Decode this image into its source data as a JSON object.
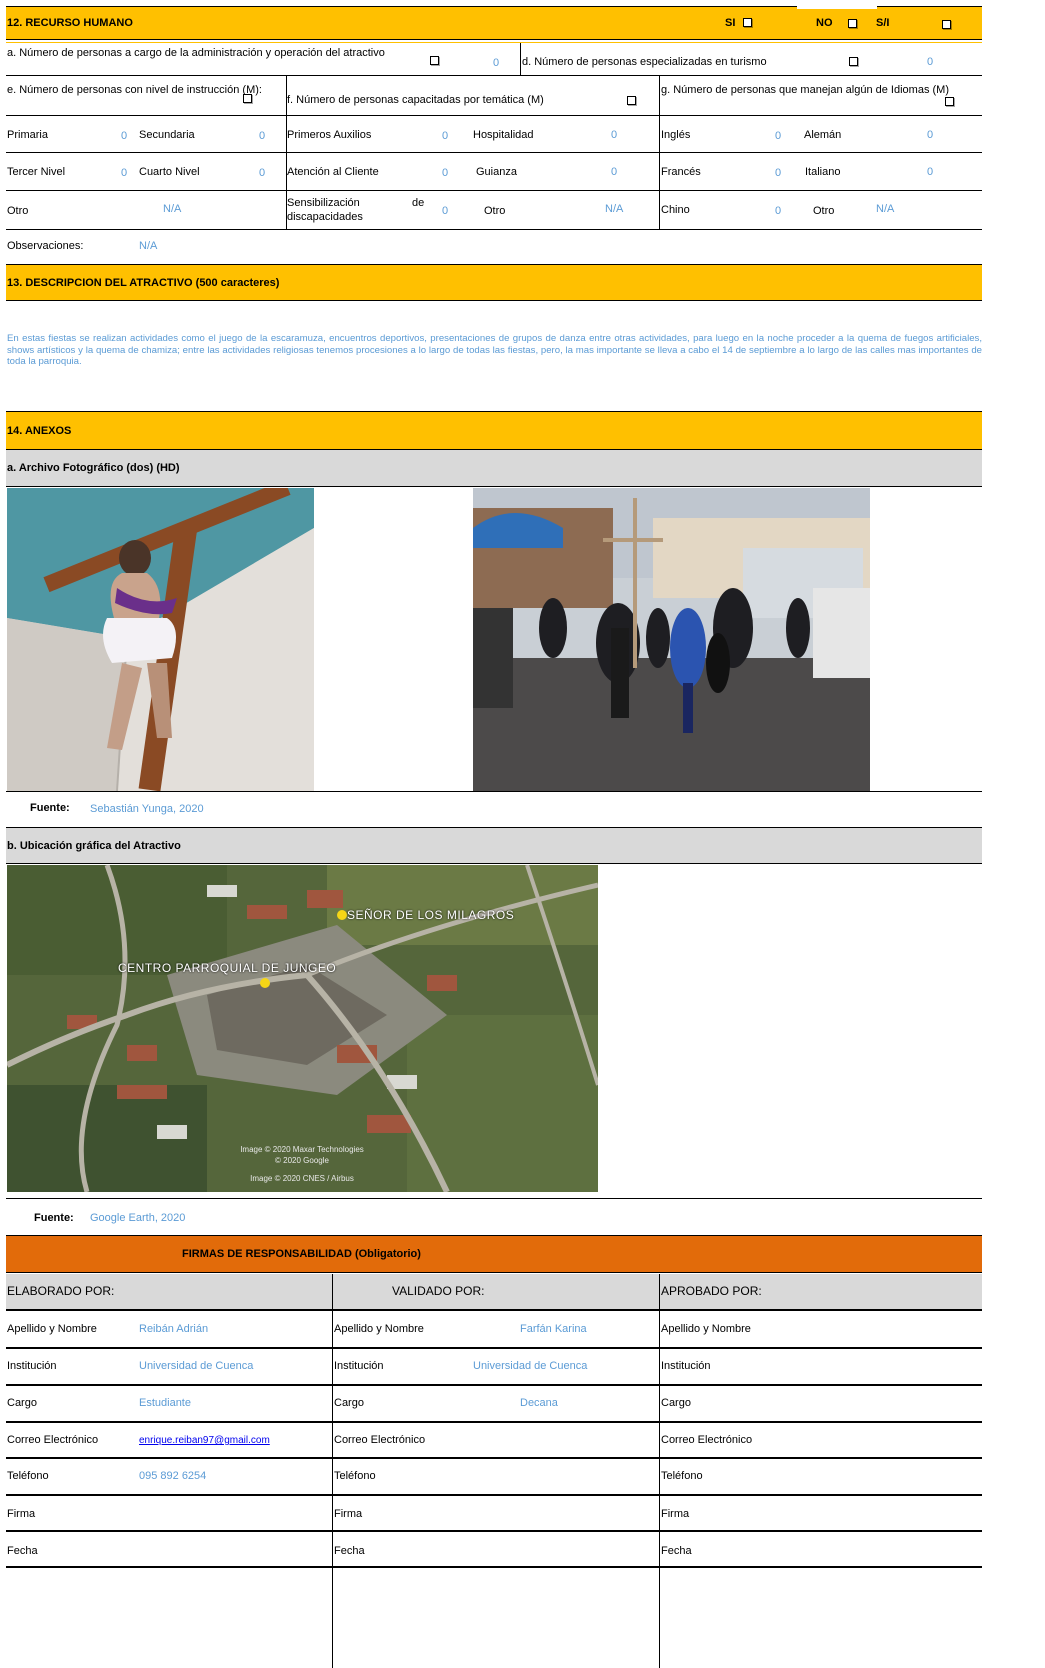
{
  "recurso_humano": {
    "title": "12. RECURSO HUMANO",
    "si_label": "SI",
    "no_label": "NO",
    "sn_label": "S/I",
    "a_label": "a. Número de personas a cargo de la administración y  operación  del atractivo",
    "a_value": "0",
    "d_label": "d. Número de personas especializadas en turismo",
    "d_value": "0",
    "e_label": "e. Número de personas con nivel de instrucción (M):",
    "f_label": "f. Número de personas capacitadas por temática (M)",
    "g_label": "g. Número de personas que manejan algún de Idiomas (M)",
    "instruccion": {
      "primaria": "Primaria",
      "primaria_val": "0",
      "secundaria": "Secundaria",
      "secundaria_val": "0",
      "tercer": "Tercer Nivel",
      "tercer_val": "0",
      "cuarto": "Cuarto Nivel",
      "cuarto_val": "0",
      "otro": "Otro",
      "otro_val": "N/A"
    },
    "capacitadas": {
      "auxilios": "Primeros Auxilios",
      "auxilios_val": "0",
      "hospitalidad": "Hospitalidad",
      "hospitalidad_val": "0",
      "atencion": "Atención al Cliente",
      "atencion_val": "0",
      "guianza": "Guianza",
      "guianza_val": "0",
      "sensib_1": "Sensibilización",
      "sensib_de": "de",
      "sensib_2": "discapacidades",
      "sensib_val": "0",
      "otro": "Otro",
      "otro_val": "N/A"
    },
    "idiomas": {
      "ingles": "Inglés",
      "ingles_val": "0",
      "aleman": "Alemán",
      "aleman_val": "0",
      "frances": "Francés",
      "frances_val": "0",
      "italiano": "Italiano",
      "italiano_val": "0",
      "chino": "Chino",
      "chino_val": "0",
      "otro": "Otro",
      "otro_val": "N/A"
    },
    "observaciones_label": "Observaciones:",
    "observaciones_val": "N/A"
  },
  "descripcion": {
    "title": "13. DESCRIPCION DEL ATRACTIVO (500 caracteres)",
    "text": "En estas fiestas se realizan actividades como el juego de la escaramuza, encuentros deportivos, presentaciones de grupos de danza entre otras actividades, para luego en la noche proceder a la quema de fuegos artificiales, shows artísticos y la quema de chamiza; entre las actividades religiosas tenemos procesiones a lo largo de todas las fiestas, pero, la mas importante se lleva a cabo el 14 de septiembre a lo largo de las calles mas importantes de toda la parroquia."
  },
  "anexos": {
    "title": "14. ANEXOS",
    "foto_title": "a. Archivo Fotográfico (dos) (HD)",
    "fuente_label": "Fuente:",
    "foto_fuente": "Sebastián Yunga, 2020",
    "ubicacion_title": "b. Ubicación gráfica del Atractivo",
    "map_label_1": "SEÑOR DE LOS MILAGROS",
    "map_label_2": "CENTRO PARROQUIAL DE JUNGEO",
    "map_credit_1": "Image © 2020 Maxar Technologies",
    "map_credit_2": "© 2020 Google",
    "map_credit_3": "Image © 2020 CNES / Airbus",
    "mapa_fuente": "Google Earth, 2020"
  },
  "firmas": {
    "title": "FIRMAS DE RESPONSABILIDAD (Obligatorio)",
    "elaborado": "ELABORADO POR:",
    "validado": "VALIDADO POR:",
    "aprobado": "APROBADO POR:",
    "labels": {
      "nombre": "Apellido y Nombre",
      "institucion": "Institución",
      "cargo": "Cargo",
      "correo": "Correo Electrónico",
      "telefono": "Teléfono",
      "firma": "Firma",
      "fecha": "Fecha"
    },
    "elab_nombre": "Reibán Adrián",
    "elab_institucion": "Universidad de Cuenca",
    "elab_cargo": "Estudiante",
    "elab_correo": "enrique.reiban97@gmail.com",
    "elab_telefono": "095 892 6254",
    "val_nombre": "Farfán Karina",
    "val_institucion": "Universidad de Cuenca",
    "val_cargo": "Decana"
  }
}
